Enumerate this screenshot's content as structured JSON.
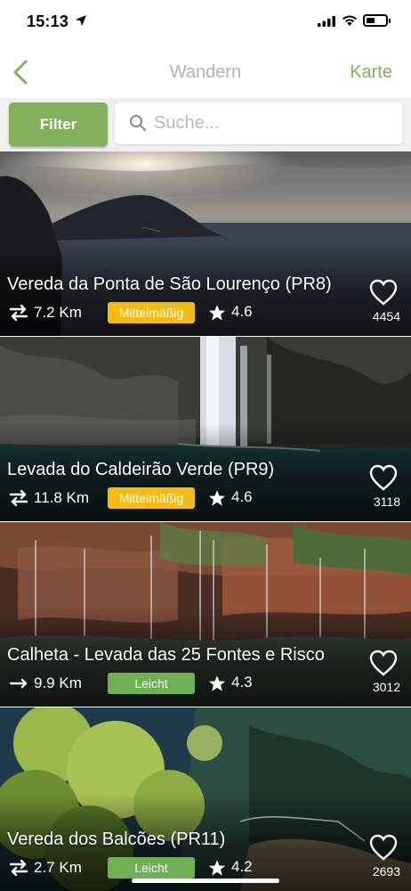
{
  "status_bar": {
    "time": "15:13",
    "icons": [
      "location-arrow-icon",
      "cellular-signal-icon",
      "wifi-icon",
      "battery-icon"
    ],
    "battery_level": 0.45
  },
  "nav": {
    "back_icon": "chevron-left-icon",
    "title": "Wandern",
    "map_label": "Karte"
  },
  "toolbar": {
    "filter_label": "Filter",
    "search_placeholder": "Suche...",
    "search_value": ""
  },
  "colors": {
    "accent_green": "#83b05a",
    "nav_link": "#7fb05b",
    "difficulty_medium": "#f4bb12",
    "difficulty_easy": "#6fb054"
  },
  "trails": [
    {
      "title": "Vereda da Ponta de São Lourenço (PR8)",
      "distance": "7.2 Km",
      "route_icon": "round-trip-icon",
      "difficulty": "Mittelmäßig",
      "difficulty_level": "medium",
      "rating": "4.6",
      "likes": "4454"
    },
    {
      "title": "Levada do Caldeirão Verde (PR9)",
      "distance": "11.8 Km",
      "route_icon": "round-trip-icon",
      "difficulty": "Mittelmäßig",
      "difficulty_level": "medium",
      "rating": "4.6",
      "likes": "3118"
    },
    {
      "title": "Calheta - Levada das 25 Fontes e Risco",
      "distance": "9.9 Km",
      "route_icon": "one-way-icon",
      "difficulty": "Leicht",
      "difficulty_level": "easy",
      "rating": "4.3",
      "likes": "3012"
    },
    {
      "title": "Vereda dos Balcões (PR11)",
      "distance": "2.7 Km",
      "route_icon": "round-trip-icon",
      "difficulty": "Leicht",
      "difficulty_level": "easy",
      "rating": "4.2",
      "likes": "2693"
    }
  ]
}
